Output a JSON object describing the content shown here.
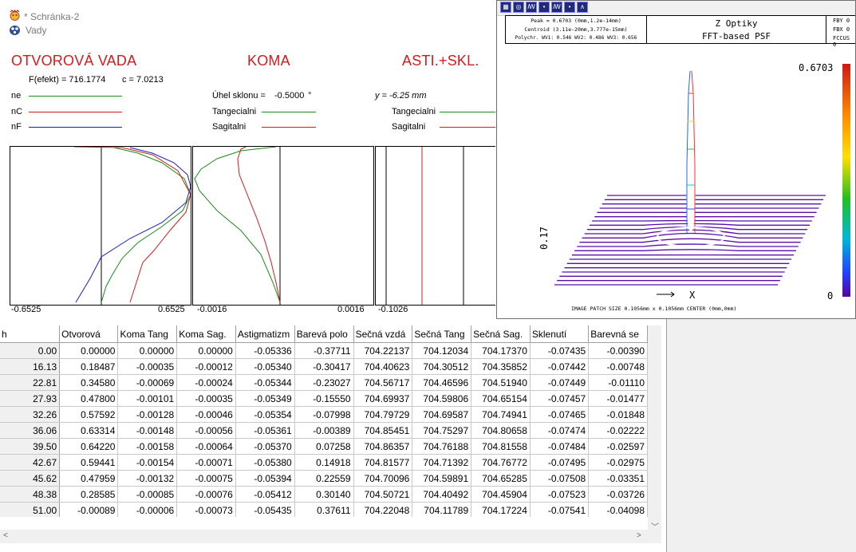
{
  "window": {
    "title": "* Schránka-2",
    "subtitle": "Vady"
  },
  "headings": {
    "spherical": "OTVOROVÁ VADA",
    "coma": "KOMA",
    "astig": "ASTI.+SKL."
  },
  "params": {
    "f_effect": "F(efekt) = 716.1774",
    "c": "c = 7.0213",
    "tilt_label": "Úhel sklonu =",
    "tilt_value": "-0.5000",
    "tilt_unit": "°",
    "y": "y = -6.25 mm"
  },
  "legend_spherical": [
    {
      "label": "ne",
      "color": "#1a8a1a"
    },
    {
      "label": "nC",
      "color": "#d01c1c"
    },
    {
      "label": "nF",
      "color": "#1c1cb8"
    }
  ],
  "legend_coma": [
    {
      "label": "Tangecialni",
      "color": "#1a8a1a"
    },
    {
      "label": "Sagitalni",
      "color": "#d01c1c"
    }
  ],
  "legend_astig": [
    {
      "label": "Tangecialni",
      "color": "#1a8a1a"
    },
    {
      "label": "Sagitalni",
      "color": "#d01c1c"
    }
  ],
  "plots": {
    "spherical": {
      "xmin": "-0.6525",
      "xmax": "0.6525"
    },
    "coma": {
      "xmin": "-0.0016",
      "xmax": "0.0016"
    },
    "astig": {
      "xmin": "-0.1026"
    }
  },
  "table": {
    "columns": [
      "h",
      "Otvorová",
      "Koma Tang",
      "Koma Sag.",
      "Astigmatizm",
      "Barevá polo",
      "Sečná vzdá",
      "Sečná Tang",
      "Sečná Sag.",
      "Sklenutí",
      "Barevná se"
    ],
    "rows": [
      [
        "0.00",
        "0.00000",
        "0.00000",
        "0.00000",
        "-0.05336",
        "-0.37711",
        "704.22137",
        "704.12034",
        "704.17370",
        "-0.07435",
        "-0.00390"
      ],
      [
        "16.13",
        "0.18487",
        "-0.00035",
        "-0.00012",
        "-0.05340",
        "-0.30417",
        "704.40623",
        "704.30512",
        "704.35852",
        "-0.07442",
        "-0.00748"
      ],
      [
        "22.81",
        "0.34580",
        "-0.00069",
        "-0.00024",
        "-0.05344",
        "-0.23027",
        "704.56717",
        "704.46596",
        "704.51940",
        "-0.07449",
        "-0.01110"
      ],
      [
        "27.93",
        "0.47800",
        "-0.00101",
        "-0.00035",
        "-0.05349",
        "-0.15550",
        "704.69937",
        "704.59806",
        "704.65154",
        "-0.07457",
        "-0.01477"
      ],
      [
        "32.26",
        "0.57592",
        "-0.00128",
        "-0.00046",
        "-0.05354",
        "-0.07998",
        "704.79729",
        "704.69587",
        "704.74941",
        "-0.07465",
        "-0.01848"
      ],
      [
        "36.06",
        "0.63314",
        "-0.00148",
        "-0.00056",
        "-0.05361",
        "-0.00389",
        "704.85451",
        "704.75297",
        "704.80658",
        "-0.07474",
        "-0.02222"
      ],
      [
        "39.50",
        "0.64220",
        "-0.00158",
        "-0.00064",
        "-0.05370",
        "0.07258",
        "704.86357",
        "704.76188",
        "704.81558",
        "-0.07484",
        "-0.02597"
      ],
      [
        "42.67",
        "0.59441",
        "-0.00154",
        "-0.00071",
        "-0.05380",
        "0.14918",
        "704.81577",
        "704.71392",
        "704.76772",
        "-0.07495",
        "-0.02975"
      ],
      [
        "45.62",
        "0.47959",
        "-0.00132",
        "-0.00075",
        "-0.05394",
        "0.22559",
        "704.70096",
        "704.59891",
        "704.65285",
        "-0.07508",
        "-0.03351"
      ],
      [
        "48.38",
        "0.28585",
        "-0.00085",
        "-0.00076",
        "-0.05412",
        "0.30140",
        "704.50721",
        "704.40492",
        "704.45904",
        "-0.07523",
        "-0.03726"
      ],
      [
        "51.00",
        "-0.00089",
        "-0.00006",
        "-0.00073",
        "-0.05435",
        "0.37611",
        "704.22048",
        "704.11789",
        "704.17224",
        "-0.07541",
        "-0.04098"
      ]
    ]
  },
  "psf": {
    "info_peak": "Peak = 0.6703 (0mm,1.2e-14mm)",
    "info_centroid": "Centroid (3.11e-20mm,3.777e-15mm)",
    "info_poly": "Polychr. WV1: 0.546 WV2: 0.486 WV3: 0.656",
    "title": "Z Optiky",
    "subtitle": "FFT-based PSF",
    "right1": "FBY 0",
    "right2": "FBX 0",
    "right3": "FCCUS 0",
    "scale_max": "0.6703",
    "scale_min": "0",
    "side_label": "0.17",
    "axis_x": "X",
    "footer": "IMAGE PATCH SIZE 0.1056mm x 0.1056mm     CENTER (0mm,0mm)"
  }
}
